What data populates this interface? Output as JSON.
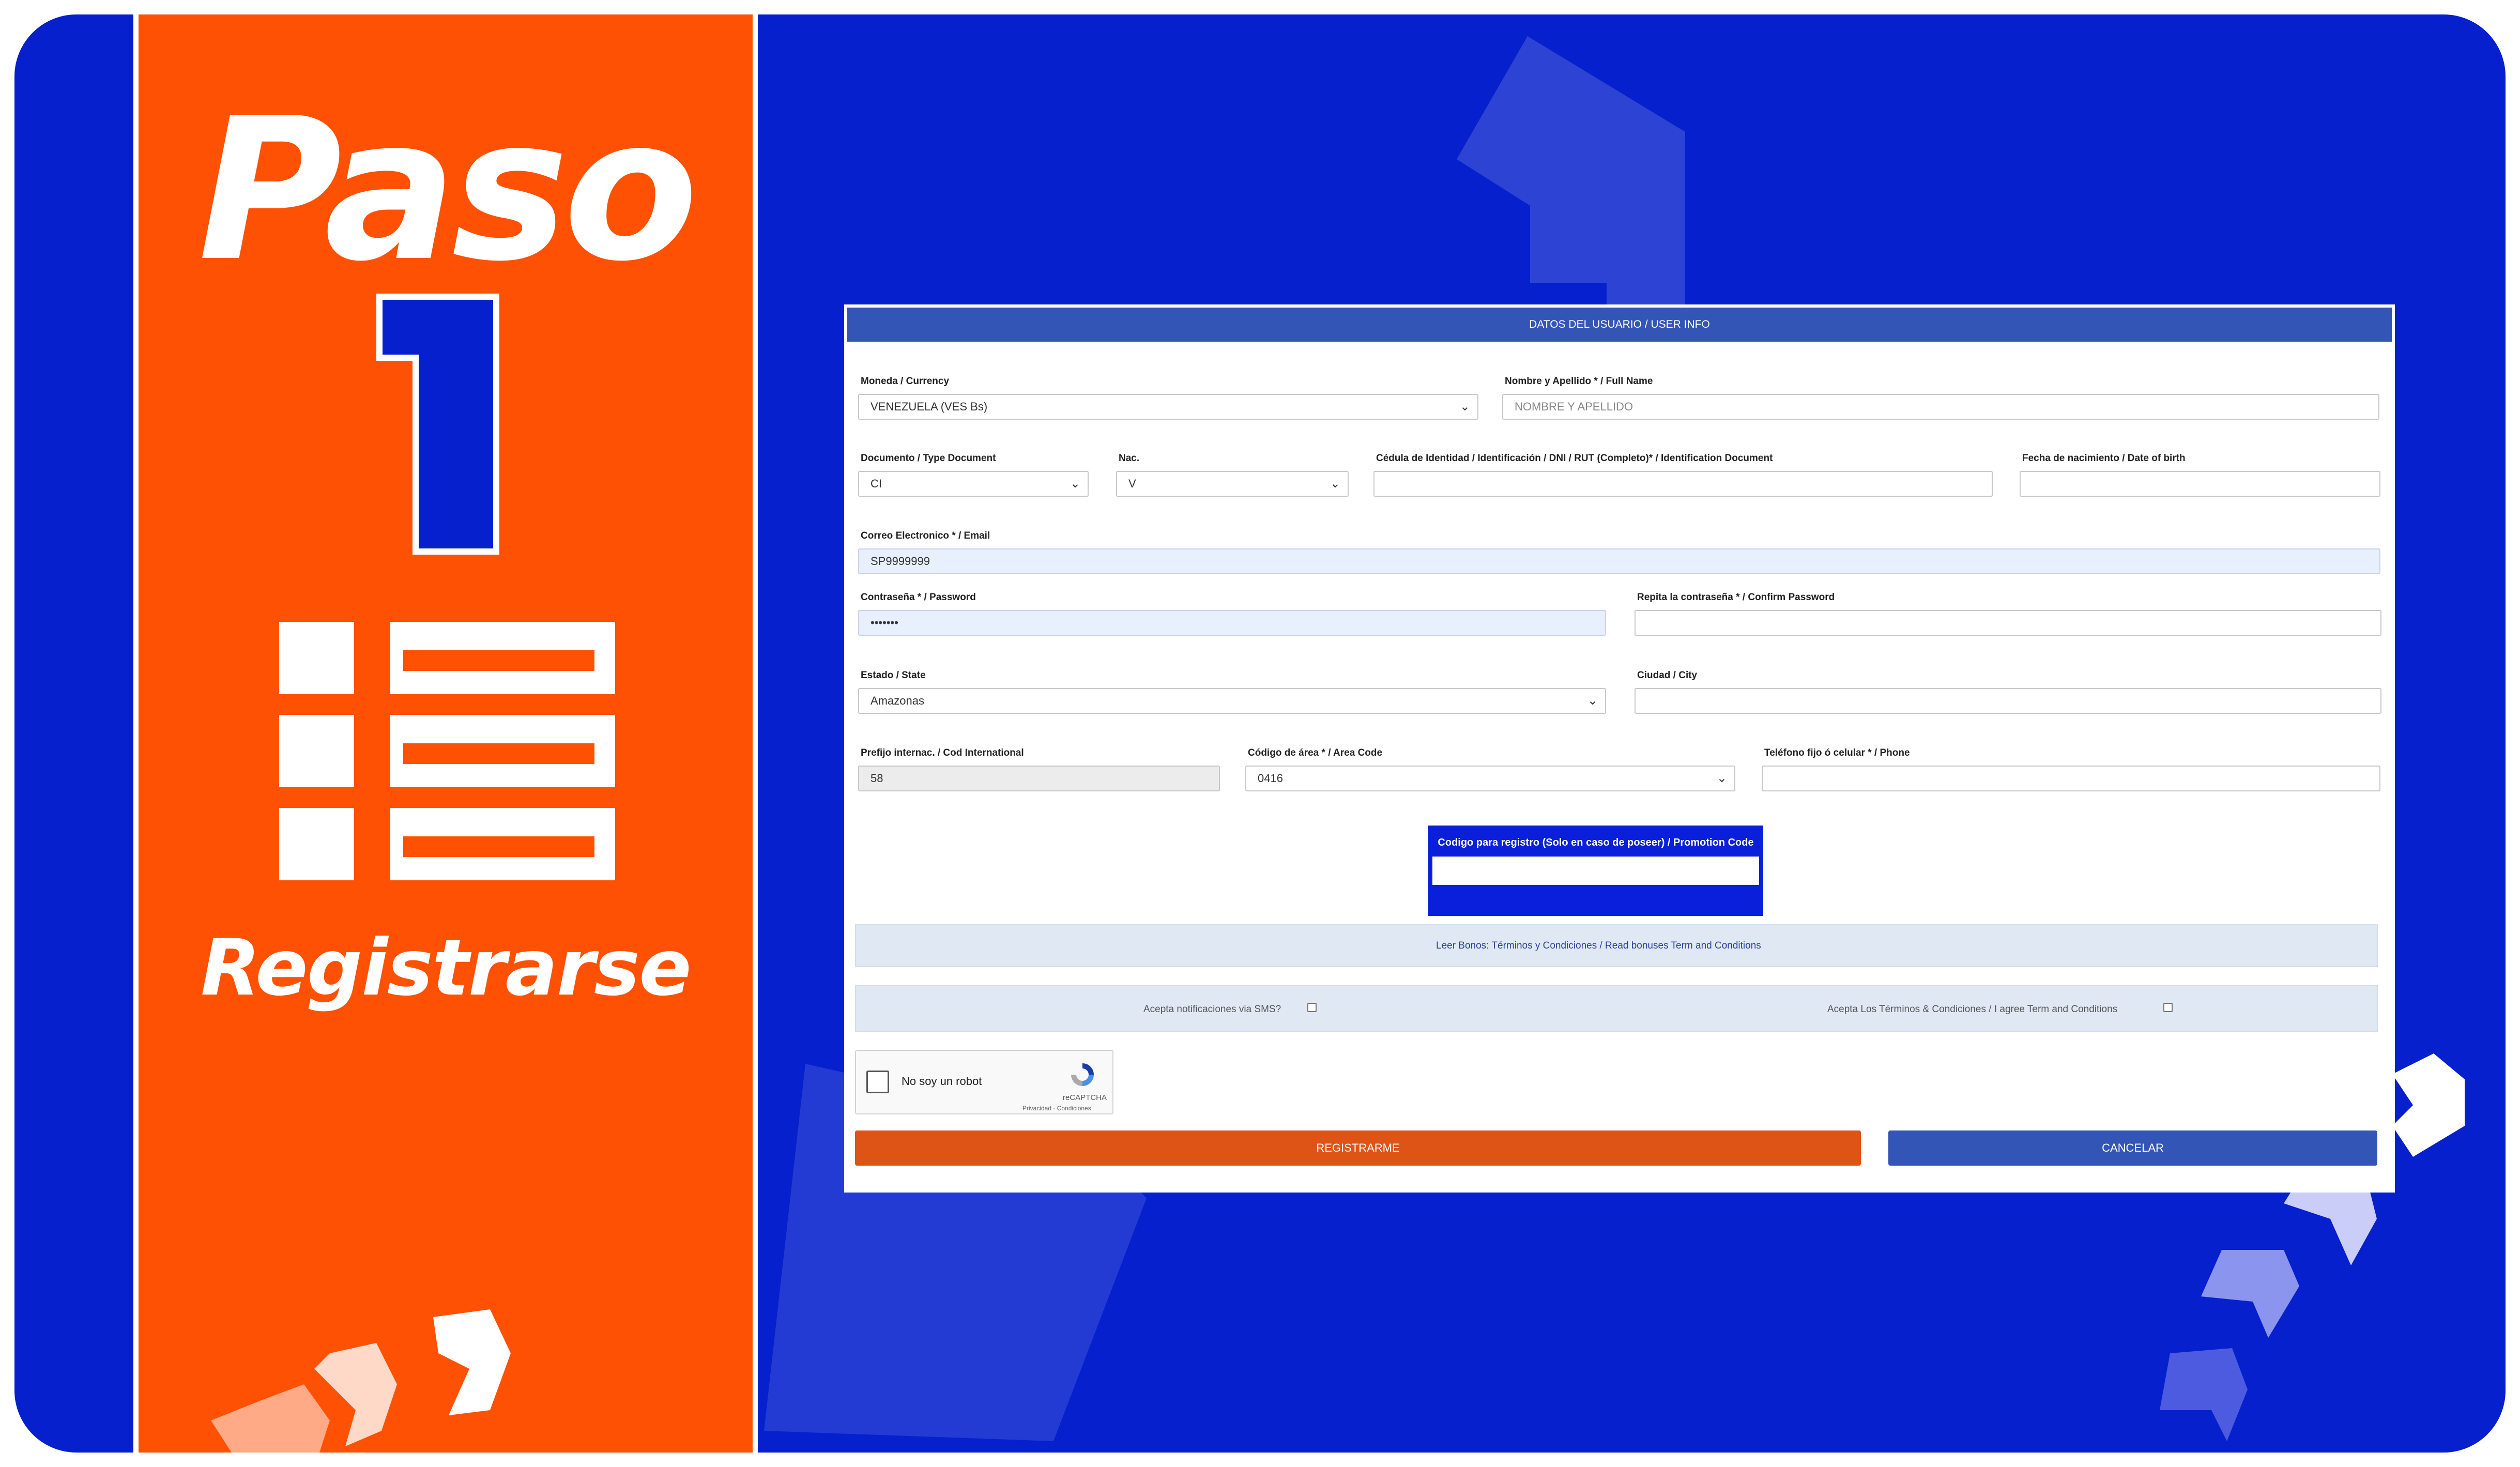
{
  "colors": {
    "card_blue": "#0520cc",
    "side_orange": "#ff5103",
    "form_header": "#3355b5",
    "register_button": "#de5417",
    "cancel_button": "#3355b5",
    "promo_box": "#0a1fd9"
  },
  "side_panel": {
    "heading": "Paso",
    "step_number": "1",
    "caption": "Registrarse",
    "icons": [
      "step-number-icon",
      "form-list-icon",
      "chevron-arrows-icon"
    ]
  },
  "form": {
    "title": "DATOS DEL USUARIO / USER INFO",
    "currency": {
      "label": "Moneda / Currency",
      "value": "VENEZUELA (VES Bs)"
    },
    "full_name": {
      "label": "Nombre y Apellido * / Full Name",
      "placeholder": "NOMBRE Y APELLIDO"
    },
    "doc_type": {
      "label": "Documento / Type Document",
      "value": "CI"
    },
    "nationality": {
      "label": "Nac.",
      "value": "V"
    },
    "id_document": {
      "label": "Cédula de Identidad / Identificación / DNI / RUT (Completo)* / Identification Document",
      "value": ""
    },
    "birth_date": {
      "label": "Fecha de nacimiento / Date of birth",
      "value": ""
    },
    "email": {
      "label": "Correo Electronico * / Email",
      "value": "SP9999999"
    },
    "password": {
      "label": "Contraseña * / Password",
      "value": "•••••••"
    },
    "confirm_password": {
      "label": "Repita la contraseña * / Confirm Password",
      "value": ""
    },
    "state": {
      "label": "Estado / State",
      "value": "Amazonas"
    },
    "city": {
      "label": "Ciudad / City",
      "value": ""
    },
    "intl_prefix": {
      "label": "Prefijo internac. / Cod International",
      "value": "58"
    },
    "area_code": {
      "label": "Código de área * / Area Code",
      "value": "0416"
    },
    "phone": {
      "label": "Teléfono fijo ó celular * / Phone",
      "value": ""
    },
    "promo": {
      "label": "Codigo para registro (Solo en caso de poseer) / Promotion Code",
      "value": ""
    },
    "bonus_link": "Leer Bonos: Términos y Condiciones / Read bonuses Term and Conditions",
    "sms_label": "Acepta notificaciones via SMS?",
    "terms_label": "Acepta Los Términos & Condiciones / I agree Term and Conditions",
    "captcha": {
      "text": "No soy un robot",
      "brand": "reCAPTCHA",
      "links": "Privacidad - Condiciones"
    },
    "register_button": "REGISTRARME",
    "cancel_button": "CANCELAR"
  }
}
